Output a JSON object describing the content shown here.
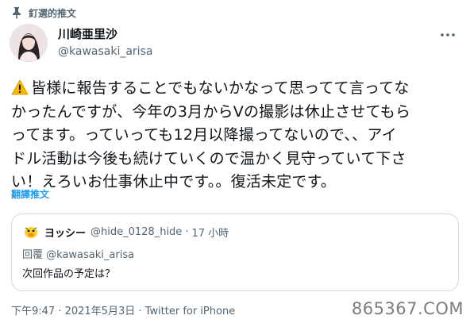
{
  "pinned": {
    "label": "釘選的推文",
    "icon": "pin-icon"
  },
  "author": {
    "display_name": "川崎亜里沙",
    "handle": "@kawasaki_arisa",
    "avatar": "avatar"
  },
  "more_icon": "more-icon",
  "tweet": {
    "lines": [
      "皆様に報告することでもないかなって思ってて言ってな",
      "かったんですが、今年の3月からVの撮影は休止させてもら",
      "ってます。っていっても12月以降撮ってないので、、アイ",
      "ドル活動は今後も続けていくので温かく見守っていて下さ",
      "い！えろいお仕事休止中です。。復活未定です。"
    ],
    "warning_icon": "warning-icon"
  },
  "translate_label": "翻譯推文",
  "quote": {
    "name": "ヨッシー",
    "handle": "@hide_0128_hide",
    "dot": "·",
    "time": "17 小時",
    "reply_prefix": "回覆",
    "reply_mention": "@kawasaki_arisa",
    "text": "次回作品の予定は？"
  },
  "meta": "下午9:47 · 2021年5月3日 · Twitter for iPhone",
  "watermark": "865367.COM",
  "colors": {
    "accent": "#1d9bf0",
    "secondary_text": "#536471",
    "border": "#cfd9de"
  }
}
